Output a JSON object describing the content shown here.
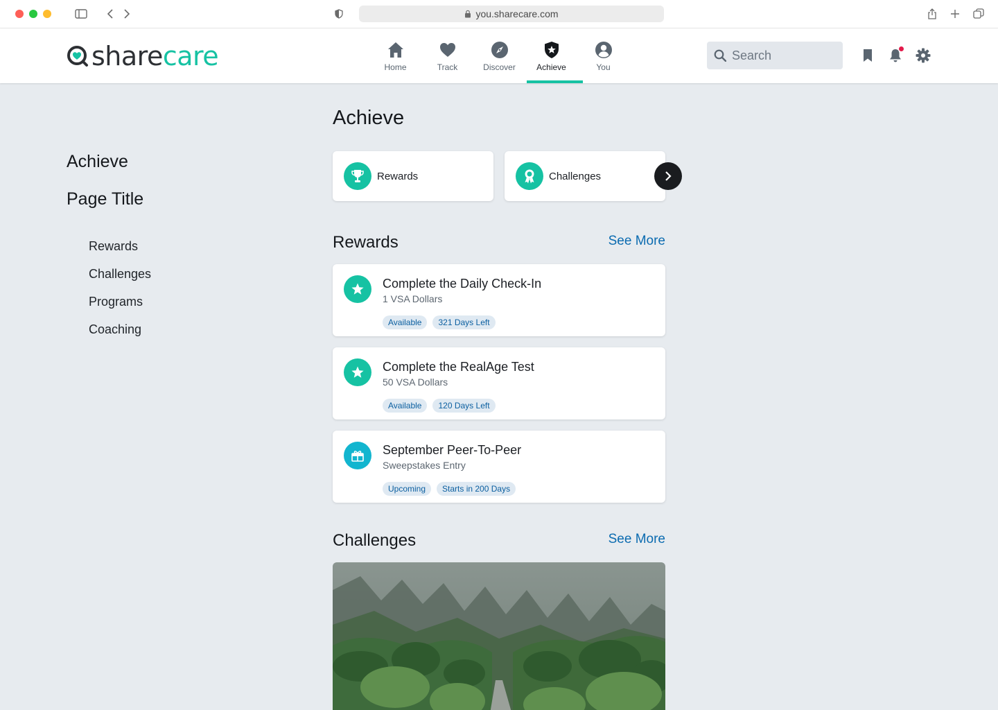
{
  "browser": {
    "url": "you.sharecare.com"
  },
  "brand": {
    "name_part1": "share",
    "name_part2": "care",
    "accent_color": "#16c2a3",
    "link_color": "#0b6bb0"
  },
  "nav": {
    "items": [
      {
        "label": "Home",
        "icon": "home-icon"
      },
      {
        "label": "Track",
        "icon": "heart-icon"
      },
      {
        "label": "Discover",
        "icon": "compass-icon"
      },
      {
        "label": "Achieve",
        "icon": "shield-star-icon",
        "active": true
      },
      {
        "label": "You",
        "icon": "user-icon"
      }
    ]
  },
  "header": {
    "search_placeholder": "Search",
    "icons": [
      "bookmark-icon",
      "bell-icon",
      "gear-icon"
    ]
  },
  "sidebar": {
    "title": "Achieve",
    "page_title": "Page Title",
    "items": [
      "Rewards",
      "Challenges",
      "Programs",
      "Coaching"
    ]
  },
  "main": {
    "title": "Achieve",
    "quick_links": [
      {
        "label": "Rewards",
        "icon": "trophy-icon"
      },
      {
        "label": "Challenges",
        "icon": "ribbon-award-icon"
      }
    ],
    "rewards_section": {
      "heading": "Rewards",
      "see_more": "See More",
      "cards": [
        {
          "title": "Complete the Daily Check-In",
          "subtitle": "1 VSA Dollars",
          "tags": [
            "Available",
            "321 Days Left"
          ],
          "icon": "star-icon"
        },
        {
          "title": "Complete the RealAge Test",
          "subtitle": "50 VSA Dollars",
          "tags": [
            "Available",
            "120 Days Left"
          ],
          "icon": "star-icon"
        },
        {
          "title": "September Peer-To-Peer",
          "subtitle": "Sweepstakes Entry",
          "tags": [
            "Upcoming",
            "Starts in 200 Days"
          ],
          "icon": "gift-icon"
        }
      ]
    },
    "challenges_section": {
      "heading": "Challenges",
      "see_more": "See More"
    }
  }
}
